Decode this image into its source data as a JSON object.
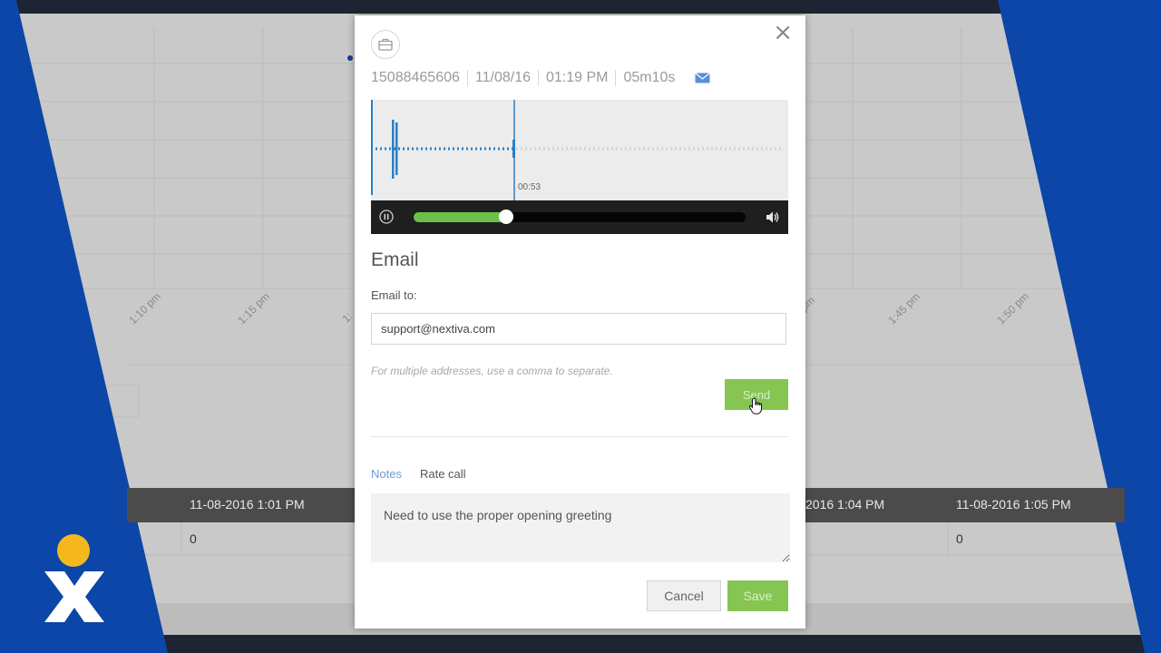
{
  "background": {
    "chart_times": [
      "1:10 pm",
      "1:15 pm",
      "1:",
      "pm",
      "1:45 pm",
      "1:50 pm"
    ],
    "table_headers": [
      "11-08-2016 1:01 PM",
      "2016 1:04 PM",
      "11-08-2016 1:05 PM"
    ],
    "table_values": [
      "0",
      "0"
    ],
    "colors": {
      "brand_blue": "#0b46a8",
      "logo_dot": "#f5b81c"
    }
  },
  "modal": {
    "close_label": "×",
    "meta": {
      "phone": "15088465606",
      "date": "11/08/16",
      "time": "01:19 PM",
      "duration": "05m10s"
    },
    "player": {
      "timestamp": "00:53",
      "progress_percent": 28
    },
    "email": {
      "title": "Email",
      "label": "Email to:",
      "value": "support@nextiva.com",
      "hint": "For multiple addresses, use a comma to separate.",
      "send_label": "Send"
    },
    "tabs": [
      "Notes",
      "Rate call"
    ],
    "notes_value": "Need to use the proper opening greeting",
    "cancel_label": "Cancel",
    "save_label": "Save",
    "colors": {
      "accent_green": "#86c552",
      "link_blue": "#6a9bd8"
    }
  }
}
